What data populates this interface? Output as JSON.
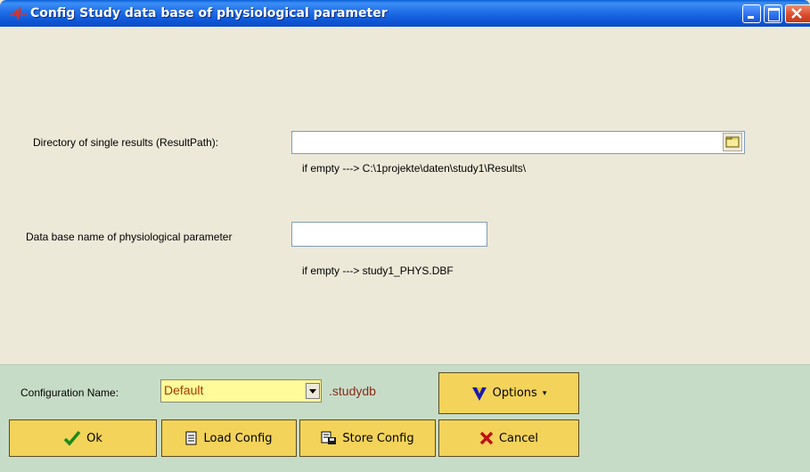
{
  "window": {
    "title": "Config Study data base of physiological parameter"
  },
  "form": {
    "result_path": {
      "label": "Directory of single results (ResultPath):",
      "value": "",
      "hint": "if empty ---> C:\\1projekte\\daten\\study1\\Results\\"
    },
    "db_name": {
      "label": "Data base name of physiological parameter",
      "value": "",
      "hint": "if empty ---> study1_PHYS.DBF"
    }
  },
  "config": {
    "label": "Configuration Name:",
    "selected": "Default",
    "extension": ".studydb"
  },
  "buttons": {
    "options": "Options",
    "ok": "Ok",
    "load": "Load Config",
    "store": "Store Config",
    "cancel": "Cancel"
  },
  "icons": {
    "title": "waveform-icon",
    "browse": "folder-icon",
    "options": "v-logo-icon",
    "ok": "checkmark-icon",
    "load": "document-icon",
    "store": "save-document-icon",
    "cancel": "x-icon"
  }
}
